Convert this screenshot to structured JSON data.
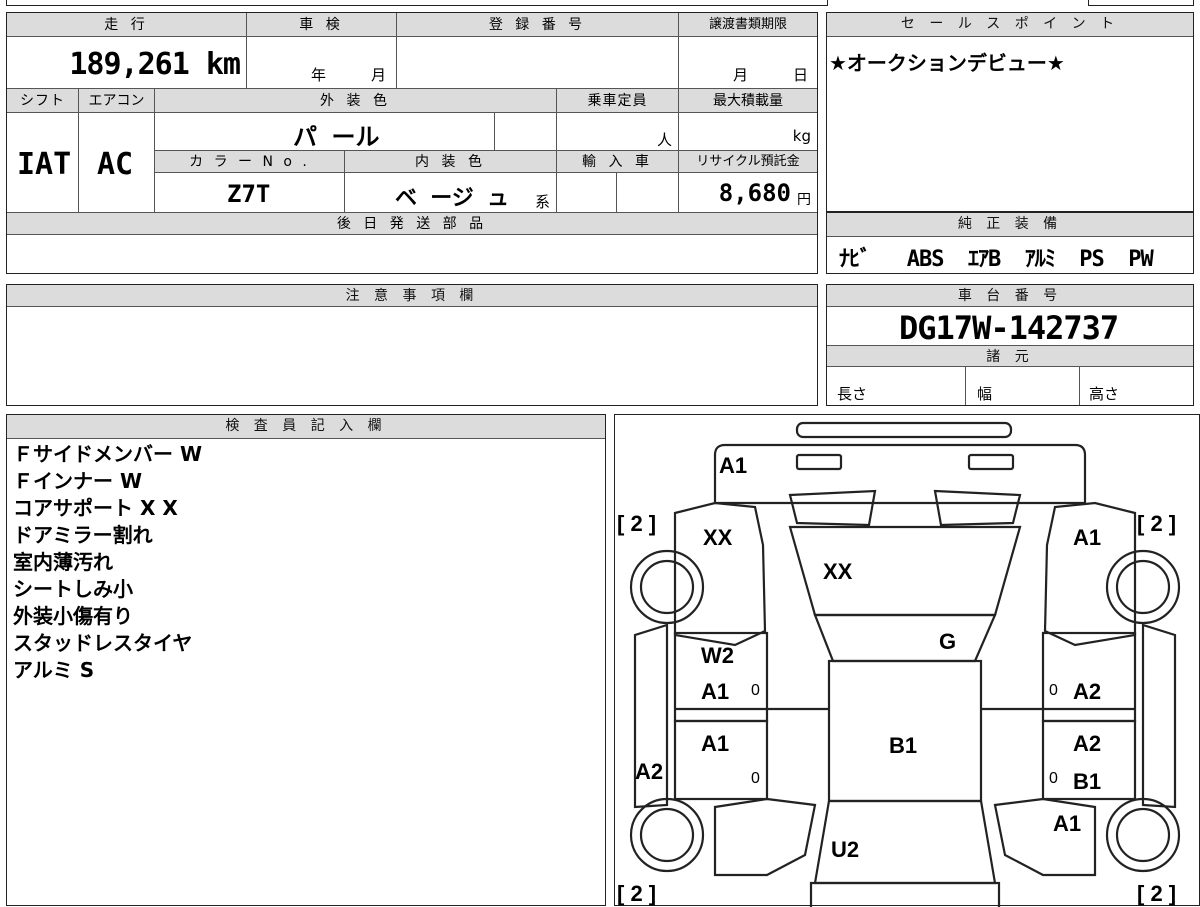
{
  "top_table": {
    "mileage_label": "走 行",
    "mileage_value": "189,261 km",
    "inspection_label": "車 検",
    "inspection_year": "年",
    "inspection_month": "月",
    "reg_label": "登 録 番 号",
    "transfer_label": "譲渡書類期限",
    "transfer_month": "月",
    "transfer_day": "日",
    "shift_label": "シフト",
    "ac_label": "エアコン",
    "shift_value": "IAT",
    "ac_value": "AC",
    "exterior_label": "外 装 色",
    "exterior_value": "パ ール",
    "capacity_label": "乗車定員",
    "capacity_unit": "人",
    "maxload_label": "最大積載量",
    "maxload_unit": "kg",
    "color_no_label": "カ ラ ー N o .",
    "color_no_value": "Z7T",
    "interior_label": "内 装 色",
    "interior_value": "ベ ージ ュ",
    "interior_suffix": "系",
    "import_label": "輸 入 車",
    "recycle_label": "リサイクル預託金",
    "recycle_value": "8,680",
    "recycle_unit": "円",
    "later_parts_label": "後 日 発 送 部 品"
  },
  "sales_point": {
    "label": "セ ー ル ス ポ イ ン ト",
    "text": "★オークションデビュー★"
  },
  "equipment": {
    "label": "純 正 装 備",
    "items": [
      "ﾅﾋﾞ",
      "ABS",
      "ｴｱB",
      "ｱﾙﾐ",
      "PS",
      "PW"
    ]
  },
  "notes": {
    "label": "注 意 事 項 欄"
  },
  "chassis": {
    "label": "車 台 番 号",
    "value": "DG17W-142737",
    "specs_label": "諸 元",
    "length": "長さ",
    "width": "幅",
    "height": "高さ"
  },
  "inspector": {
    "label": "検 査 員 記 入 欄",
    "lines": [
      "Ｆサイドメンバー W",
      "Ｆインナー W",
      "コアサポート X X",
      "ドアミラー割れ",
      "室内薄汚れ",
      "シートしみ小",
      "外装小傷有り",
      "スタッドレスタイヤ",
      "アルミ S"
    ]
  },
  "diagram": {
    "marks": {
      "front_bumper": "A1",
      "front_left_fender": "XX",
      "hood": "XX",
      "front_right_fender": "A1",
      "windshield": "G",
      "left_front_door_1": "W2",
      "left_front_door_2": "A1",
      "left_rear_door": "A1",
      "left_sill": "A2",
      "roof": "B1",
      "right_front_door": "A2",
      "right_rear_door_1": "A2",
      "right_rear_door_2": "B1",
      "right_rear_quarter": "A1",
      "tailgate": "U2",
      "zero_lf": "0",
      "zero_lr": "0",
      "zero_rf": "0",
      "zero_rr": "0"
    },
    "tires": {
      "front_left": "[ 2 ]",
      "front_right": "[ 2 ]",
      "rear_left": "[ 2 ]",
      "rear_right": "[ 2 ]"
    }
  }
}
